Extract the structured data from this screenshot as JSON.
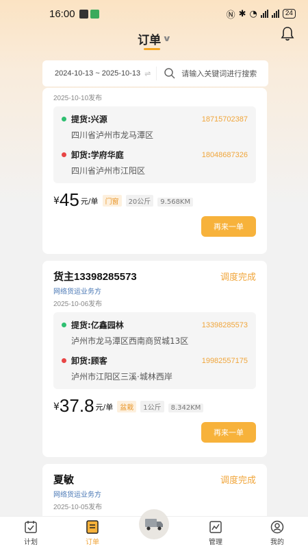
{
  "status_bar": {
    "time": "16:00",
    "battery": "24"
  },
  "nav": {
    "title": "订单"
  },
  "search": {
    "date_range": "2024-10-13 ~ 2025-10-13",
    "placeholder": "请输入关键词进行搜索"
  },
  "orders": [
    {
      "owner": "",
      "status": "",
      "service_type": "",
      "date": "2025-10-10发布",
      "pickup": {
        "label": "提货:兴源",
        "phone": "18715702387",
        "address": "四川省泸州市龙马潭区"
      },
      "dropoff": {
        "label": "卸货:学府华庭",
        "phone": "18048687326",
        "address": "四川省泸州市江阳区"
      },
      "currency": "¥",
      "price": "45",
      "price_unit": "元/单",
      "tags": [
        "门窗",
        "20公斤",
        "9.568KM"
      ],
      "button": "再来一单"
    },
    {
      "owner": "货主13398285573",
      "status": "调度完成",
      "service_type": "网络货运业务方",
      "date": "2025-10-06发布",
      "pickup": {
        "label": "提货:亿鑫园林",
        "phone": "13398285573",
        "address": "泸州市龙马潭区西南商贸城13区"
      },
      "dropoff": {
        "label": "卸货:顾客",
        "phone": "19982557175",
        "address": "泸州市江阳区三溪·城林西岸"
      },
      "currency": "¥",
      "price": "37.8",
      "price_unit": "元/单",
      "tags": [
        "盆栽",
        "1公斤",
        "8.342KM"
      ],
      "button": "再来一单"
    },
    {
      "owner": "夏敏",
      "status": "调度完成",
      "service_type": "网络货运业务方",
      "date": "2025-10-05发布"
    }
  ],
  "tabbar": [
    {
      "label": "计划",
      "icon": "plan-icon"
    },
    {
      "label": "订单",
      "icon": "order-icon"
    },
    {
      "label": "",
      "icon": "truck-icon"
    },
    {
      "label": "管理",
      "icon": "chart-icon"
    },
    {
      "label": "我的",
      "icon": "profile-icon"
    }
  ],
  "colors": {
    "accent": "#f7b23b",
    "status": "#f0a53a",
    "link_blue": "#4a78b5"
  }
}
